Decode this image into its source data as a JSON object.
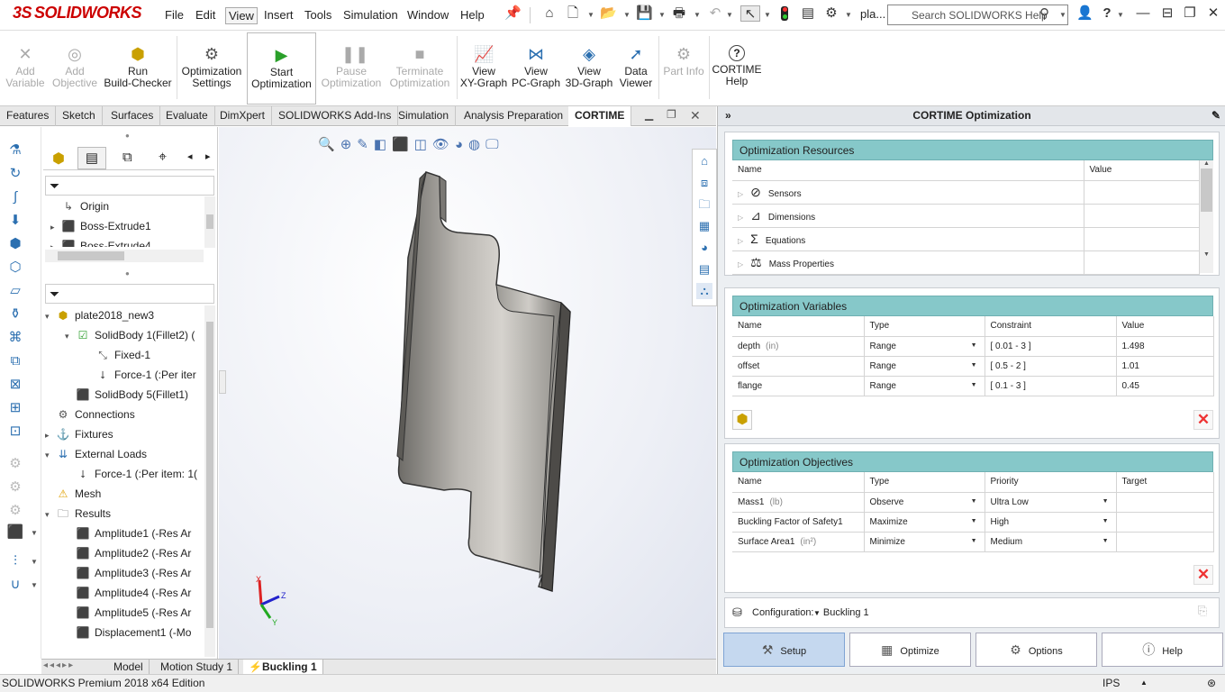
{
  "app": {
    "logo": "SOLIDWORKS",
    "logo_mark": "3S",
    "doc_short": "pla..."
  },
  "menu": [
    "File",
    "Edit",
    "View",
    "Insert",
    "Tools",
    "Simulation",
    "Window",
    "Help"
  ],
  "search": {
    "placeholder": "Search SOLIDWORKS Help"
  },
  "ribbon": [
    {
      "label": "Add Variable",
      "l1": "Add",
      "l2": "Variable",
      "disabled": true,
      "icon": "add-variable-icon"
    },
    {
      "label": "Add Objective",
      "l1": "Add",
      "l2": "Objective",
      "disabled": true,
      "icon": "add-objective-icon"
    },
    {
      "label": "Run Build-Checker",
      "l1": "Run",
      "l2": "Build-Checker",
      "disabled": false,
      "icon": "build-checker-icon"
    },
    {
      "label": "Optimization Settings",
      "l1": "Optimization",
      "l2": "Settings",
      "disabled": false,
      "icon": "gear-icon"
    },
    {
      "label": "Start Optimization",
      "l1": "Start",
      "l2": "Optimization",
      "disabled": false,
      "icon": "play-icon"
    },
    {
      "label": "Pause Optimization",
      "l1": "Pause",
      "l2": "Optimization",
      "disabled": true,
      "icon": "pause-icon"
    },
    {
      "label": "Terminate Optimization",
      "l1": "Terminate",
      "l2": "Optimization",
      "disabled": true,
      "icon": "stop-icon"
    },
    {
      "label": "View XY-Graph",
      "l1": "View",
      "l2": "XY-Graph",
      "disabled": false,
      "icon": "xy-graph-icon"
    },
    {
      "label": "View PC-Graph",
      "l1": "View",
      "l2": "PC-Graph",
      "disabled": false,
      "icon": "pc-graph-icon"
    },
    {
      "label": "View 3D-Graph",
      "l1": "View",
      "l2": "3D-Graph",
      "disabled": false,
      "icon": "3d-graph-icon"
    },
    {
      "label": "Data Viewer",
      "l1": "Data",
      "l2": "Viewer",
      "disabled": false,
      "icon": "data-viewer-icon"
    },
    {
      "label": "Part Info",
      "l1": "Part Info",
      "l2": "",
      "disabled": true,
      "icon": "part-info-icon"
    },
    {
      "label": "CORTIME Help",
      "l1": "CORTIME",
      "l2": "Help",
      "disabled": false,
      "icon": "help-icon"
    }
  ],
  "tabs": [
    "Features",
    "Sketch",
    "Surfaces",
    "Evaluate",
    "DimXpert",
    "SOLIDWORKS Add-Ins",
    "Simulation",
    "Analysis Preparation",
    "CORTIME"
  ],
  "feature_tree": [
    {
      "label": "Origin",
      "icon": "origin-icon"
    },
    {
      "label": "Boss-Extrude1",
      "icon": "extrude-icon"
    },
    {
      "label": "Boss-Extrude4",
      "icon": "extrude-icon"
    }
  ],
  "sim_tree": [
    {
      "label": "plate2018_new3",
      "indent": 0,
      "expand": "▾",
      "icon": "study-icon"
    },
    {
      "label": "SolidBody 1(Fillet2) (",
      "indent": 1,
      "expand": "▾",
      "icon": "solidbody-icon"
    },
    {
      "label": "Fixed-1",
      "indent": 2,
      "expand": "",
      "icon": "fixed-icon"
    },
    {
      "label": "Force-1 (:Per iter",
      "indent": 2,
      "expand": "",
      "icon": "force-icon"
    },
    {
      "label": "SolidBody 5(Fillet1)",
      "indent": 1,
      "expand": "",
      "icon": "solidbody-icon"
    },
    {
      "label": "Connections",
      "indent": 0,
      "expand": "",
      "icon": "connections-icon"
    },
    {
      "label": "Fixtures",
      "indent": 0,
      "expand": "▸",
      "icon": "fixtures-icon"
    },
    {
      "label": "External Loads",
      "indent": 0,
      "expand": "▾",
      "icon": "external-loads-icon"
    },
    {
      "label": "Force-1 (:Per item: 1(",
      "indent": 1,
      "expand": "",
      "icon": "force-icon"
    },
    {
      "label": "Mesh",
      "indent": 0,
      "expand": "",
      "icon": "mesh-warning-icon"
    },
    {
      "label": "Results",
      "indent": 0,
      "expand": "▾",
      "icon": "results-folder-icon"
    },
    {
      "label": "Amplitude1 (-Res Ar",
      "indent": 1,
      "expand": "",
      "icon": "plot-icon"
    },
    {
      "label": "Amplitude2 (-Res Ar",
      "indent": 1,
      "expand": "",
      "icon": "plot-icon"
    },
    {
      "label": "Amplitude3 (-Res Ar",
      "indent": 1,
      "expand": "",
      "icon": "plot-icon"
    },
    {
      "label": "Amplitude4 (-Res Ar",
      "indent": 1,
      "expand": "",
      "icon": "plot-icon"
    },
    {
      "label": "Amplitude5 (-Res Ar",
      "indent": 1,
      "expand": "",
      "icon": "plot-icon"
    },
    {
      "label": "Displacement1 (-Mo",
      "indent": 1,
      "expand": "",
      "icon": "plot-icon"
    }
  ],
  "triad": {
    "x": "X",
    "y": "Y",
    "z": "Z"
  },
  "bottom_tabs": [
    "Model",
    "Motion Study 1",
    "Buckling 1"
  ],
  "status": {
    "left": "SOLIDWORKS Premium 2018 x64 Edition",
    "units": "IPS"
  },
  "cortime": {
    "title": "CORTIME Optimization",
    "resources": {
      "header": "Optimization Resources",
      "cols": [
        "Name",
        "Value"
      ],
      "rows": [
        {
          "name": "Sensors",
          "icon": "sensor-gauge-icon"
        },
        {
          "name": "Dimensions",
          "icon": "dimension-icon"
        },
        {
          "name": "Equations",
          "icon": "sigma-icon"
        },
        {
          "name": "Mass Properties",
          "icon": "scale-icon"
        }
      ]
    },
    "variables": {
      "header": "Optimization Variables",
      "cols": [
        "Name",
        "Type",
        "Constraint",
        "Value"
      ],
      "rows": [
        {
          "name": "depth",
          "unit": "(in)",
          "type": "Range",
          "constraint": "[ 0.01  -  3 ]",
          "value": "1.498"
        },
        {
          "name": "offset",
          "unit": "",
          "type": "Range",
          "constraint": "[ 0.5  -  2 ]",
          "value": "1.01"
        },
        {
          "name": "flange",
          "unit": "",
          "type": "Range",
          "constraint": "[ 0.1  -  3 ]",
          "value": "0.45"
        }
      ]
    },
    "objectives": {
      "header": "Optimization Objectives",
      "cols": [
        "Name",
        "Type",
        "Priority",
        "Target"
      ],
      "rows": [
        {
          "name": "Mass1",
          "unit": "(lb)",
          "type": "Observe",
          "priority": "Ultra Low",
          "target": ""
        },
        {
          "name": "Buckling Factor of Safety1",
          "unit": "",
          "type": "Maximize",
          "priority": "High",
          "target": ""
        },
        {
          "name": "Surface Area1",
          "unit": "(in²)",
          "type": "Minimize",
          "priority": "Medium",
          "target": ""
        }
      ]
    },
    "configuration": {
      "label": "Configuration:",
      "value": "Buckling 1"
    },
    "buttons": [
      {
        "label": "Setup",
        "icon": "setup-icon",
        "selected": true
      },
      {
        "label": "Optimize",
        "icon": "optimize-chart-icon",
        "selected": false
      },
      {
        "label": "Options",
        "icon": "gear-icon",
        "selected": false
      },
      {
        "label": "Help",
        "icon": "help-icon",
        "selected": false
      }
    ]
  }
}
